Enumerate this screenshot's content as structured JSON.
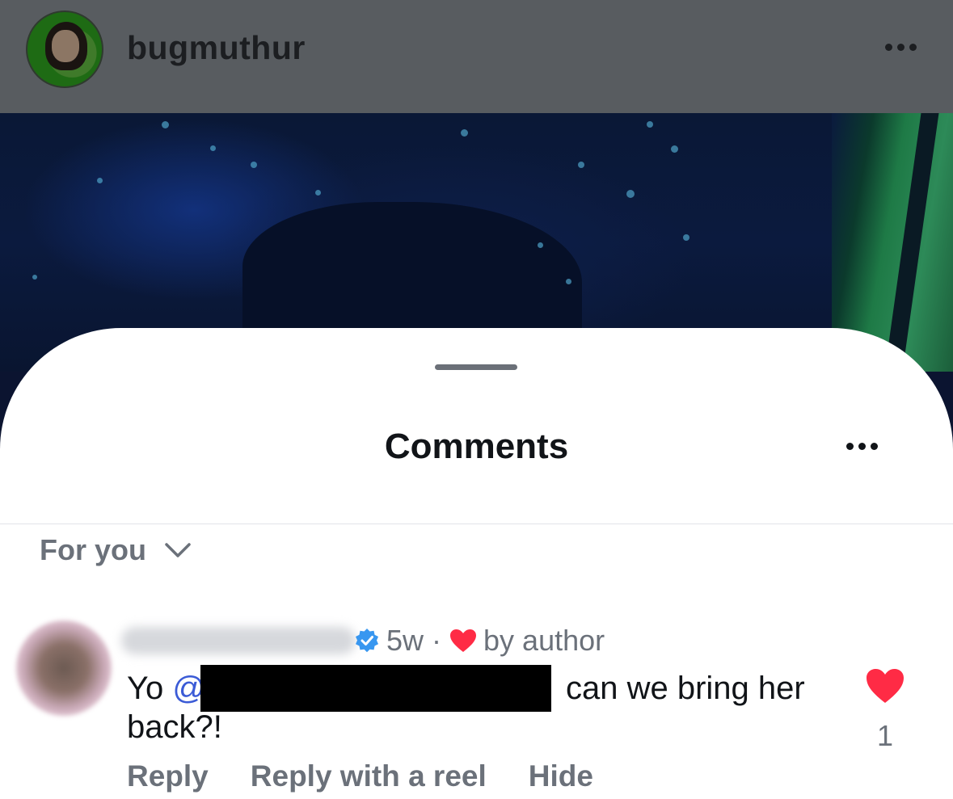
{
  "header": {
    "username": "bugmuthur"
  },
  "sheet": {
    "title": "Comments",
    "sort_label": "For you"
  },
  "comment": {
    "age": "5w",
    "separator": "·",
    "liked_by_author_label": "by author",
    "text_start": "Yo ",
    "mention_prefix": "@",
    "text_end": "can we bring her back?!",
    "like_count": "1",
    "actions": {
      "reply": "Reply",
      "reply_with_reel": "Reply with a reel",
      "hide": "Hide"
    }
  },
  "colors": {
    "heart": "#ff2b45",
    "verified": "#3897f0",
    "mention": "#3b5bd6"
  },
  "icons": {
    "post_menu": "more-horizontal-icon",
    "sheet_menu": "more-horizontal-icon",
    "sort": "chevron-down-icon",
    "verified": "verified-badge-icon",
    "author_heart": "heart-icon",
    "like": "heart-icon"
  }
}
